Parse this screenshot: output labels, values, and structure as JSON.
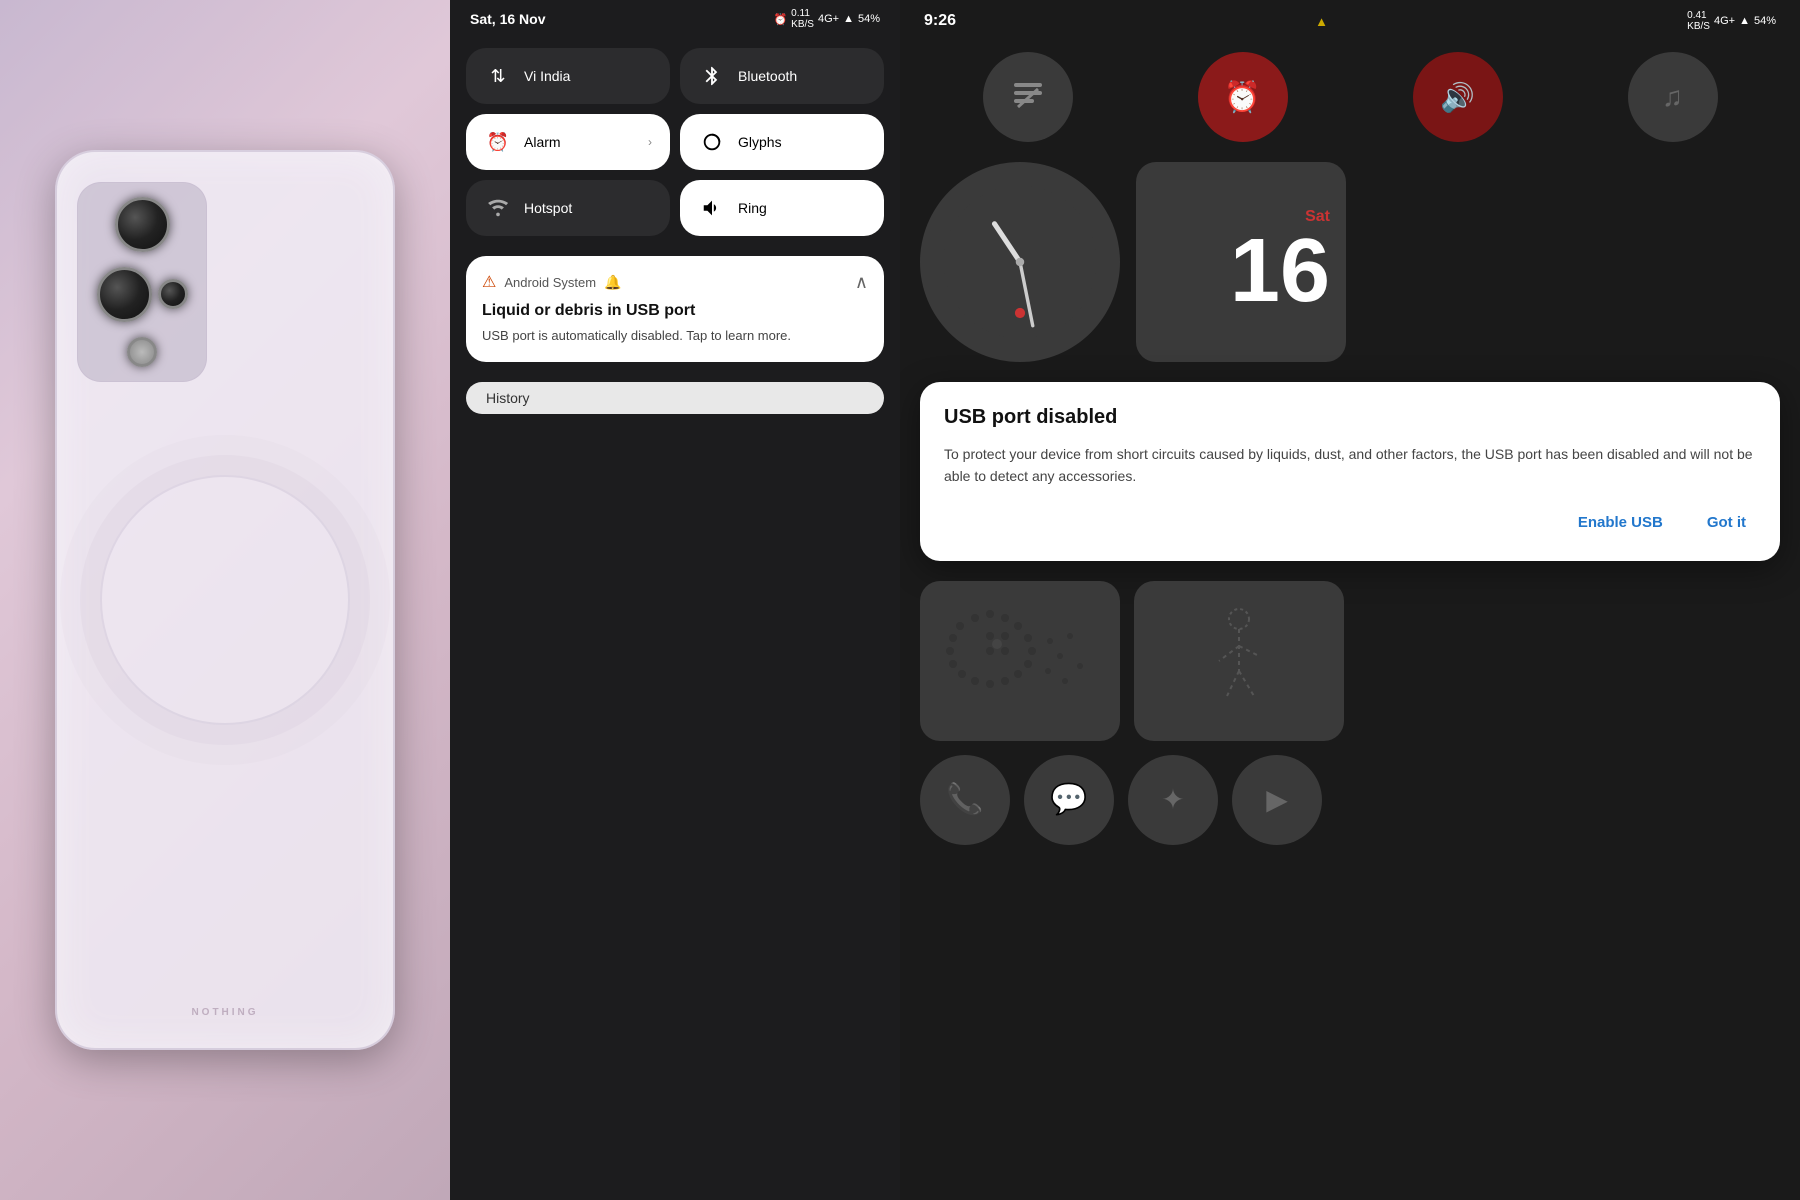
{
  "left": {
    "label": "phone-back-image"
  },
  "middle": {
    "status_bar": {
      "date": "Sat, 16 Nov",
      "icons": {
        "alarm": "⏰",
        "network_speed": "0.11 KB/S",
        "network_type": "4G+",
        "signal": "▲",
        "battery": "54%"
      }
    },
    "tiles": [
      {
        "id": "vi-india",
        "label": "Vi India",
        "icon": "⇅",
        "active": false,
        "has_arrow": false
      },
      {
        "id": "bluetooth",
        "label": "Bluetooth",
        "icon": "Ƀ",
        "active": false,
        "has_arrow": false
      },
      {
        "id": "alarm",
        "label": "Alarm",
        "icon": "⏰",
        "active": true,
        "has_arrow": true
      },
      {
        "id": "glyphs",
        "label": "Glyphs",
        "icon": "✳",
        "active": true,
        "has_arrow": false
      },
      {
        "id": "hotspot",
        "label": "Hotspot",
        "icon": "📡",
        "active": false,
        "has_arrow": false
      },
      {
        "id": "ring",
        "label": "Ring",
        "icon": "🔔",
        "active": true,
        "has_arrow": false
      }
    ],
    "notification": {
      "source": "Android System",
      "bell_icon": "🔔",
      "title": "Liquid or debris in USB port",
      "body": "USB port is automatically disabled. Tap to learn more.",
      "warning_icon": "⚠"
    },
    "history_button": "History"
  },
  "right": {
    "status_bar": {
      "time": "9:26",
      "warning_icon": "▲",
      "network_speed": "0.41 KB/S",
      "network_type": "4G+",
      "battery": "54%"
    },
    "top_icons": [
      {
        "id": "icon1",
        "symbol": "⊟",
        "active": false
      },
      {
        "id": "icon2",
        "symbol": "⏰",
        "active": true,
        "color": "red"
      },
      {
        "id": "icon3",
        "symbol": "🔊",
        "active": true,
        "color": "dark-red"
      },
      {
        "id": "icon4",
        "symbol": "♫",
        "active": false
      }
    ],
    "calendar": {
      "day_name": "Sat",
      "day_number": "16"
    },
    "usb_dialog": {
      "title": "USB port disabled",
      "body": "To protect your device from short circuits caused by liquids, dust, and other factors, the USB port has been disabled and will not be able to detect any accessories.",
      "enable_usb_label": "Enable USB",
      "got_it_label": "Got it"
    },
    "bottom_app_icons": [
      {
        "id": "phone",
        "symbol": "📞"
      },
      {
        "id": "chat",
        "symbol": "💬"
      },
      {
        "id": "fan",
        "symbol": "✦"
      },
      {
        "id": "youtube",
        "symbol": "▶"
      }
    ]
  }
}
